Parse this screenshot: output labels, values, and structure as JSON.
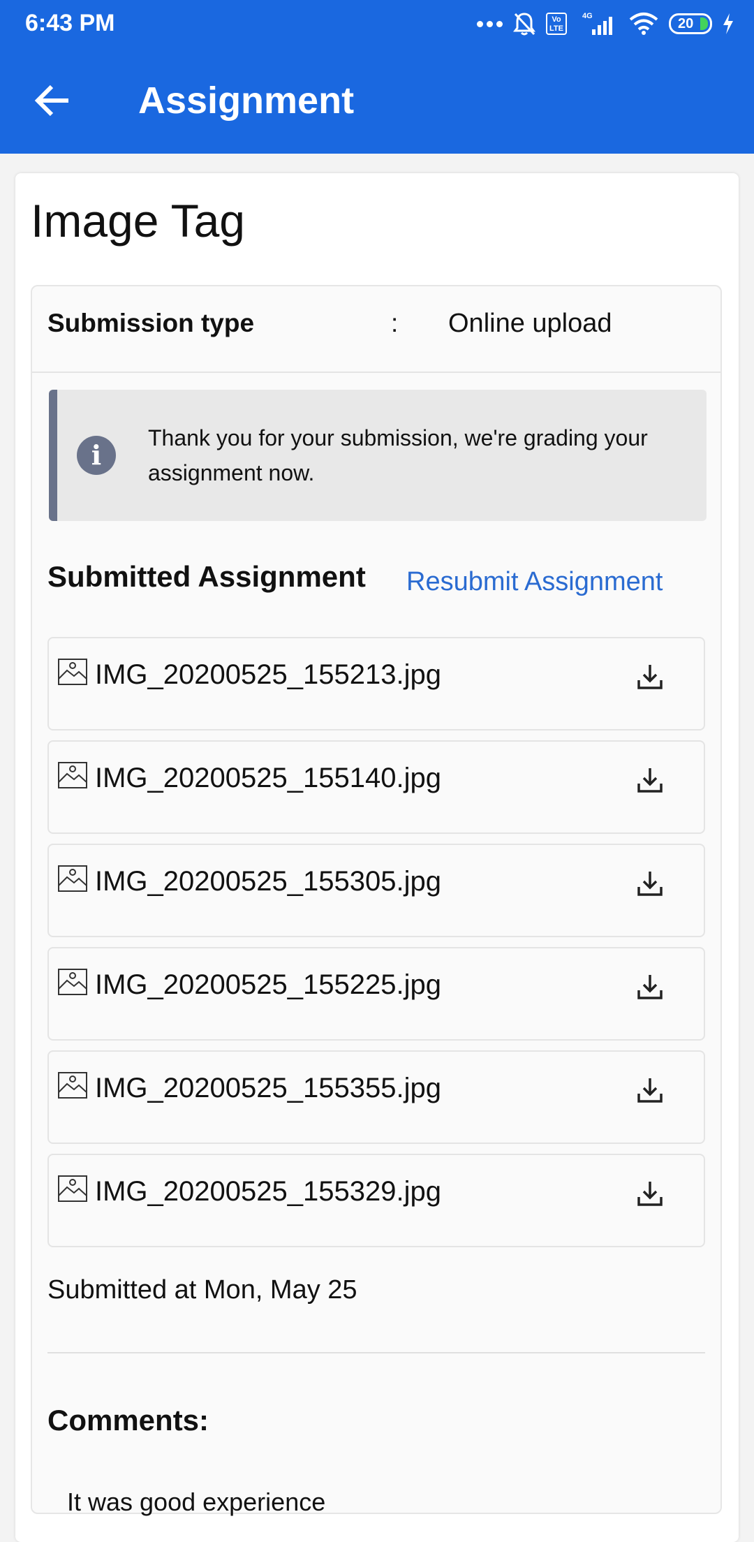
{
  "status_bar": {
    "time": "6:43 PM",
    "network": "4G",
    "volte": "Vo LTE",
    "battery": "20"
  },
  "app_bar": {
    "title": "Assignment"
  },
  "assignment": {
    "name": "Image Tag",
    "submission_type_label": "Submission type",
    "colon": ":",
    "submission_type_value": "Online upload",
    "info_message": "Thank you for your submission, we're grading your assignment now.",
    "submitted_title": "Submitted Assignment",
    "resubmit_label": "Resubmit Assignment",
    "files": [
      "IMG_20200525_155213.jpg",
      "IMG_20200525_155140.jpg",
      "IMG_20200525_155305.jpg",
      "IMG_20200525_155225.jpg",
      "IMG_20200525_155355.jpg",
      "IMG_20200525_155329.jpg"
    ],
    "submitted_at": "Submitted at Mon, May 25",
    "comments_title": "Comments:",
    "comment": "It was good experience"
  },
  "colors": {
    "app_bar": "#1a68e0",
    "link": "#2a6bd1",
    "info_accent": "#69728a"
  }
}
